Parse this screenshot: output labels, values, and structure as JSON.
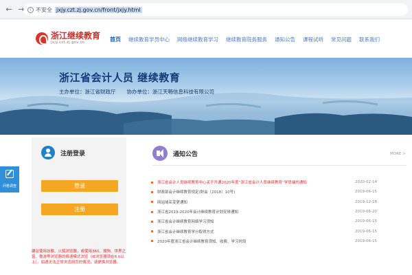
{
  "browser": {
    "back_glyph": "←",
    "forward_glyph": "→",
    "reload_glyph": "↻",
    "info_glyph": "i",
    "insecure_label": "不安全",
    "url": "jxjy.czt.zj.gov.cn/front/jxjy.html"
  },
  "header": {
    "logo_title": "浙江继续教育",
    "logo_sub": "jxjy.czt.zj.gov.cn",
    "nav": [
      {
        "label": "首页",
        "active": true
      },
      {
        "label": "继续教育学员中心"
      },
      {
        "label": "网络继续教育学习"
      },
      {
        "label": "继续教育院务服务"
      },
      {
        "label": "通知公告"
      },
      {
        "label": "课程试听"
      },
      {
        "label": "常见问题"
      },
      {
        "label": "联系我们"
      }
    ]
  },
  "banner": {
    "title": "浙江省会计人员 继续教育",
    "sponsor": "主办单位：浙江省财政厅",
    "co_organizer": "协办单位：浙江天畅信息科技有限公司"
  },
  "login_panel": {
    "title": "注册登录",
    "login_label": "登录",
    "register_label": "注册",
    "note": "建议使用谷歌、火狐浏览器，或使用360、搜狗、世界之窗、傲游等浏览器的极速模式浏览（IE浏览器须在8.0以上）。如遇无法正常浏览网页的情况，请更换浏览器。"
  },
  "float_widget": {
    "label": "问卷调查"
  },
  "notices": {
    "title": "通知公告",
    "more_label": "MORE >",
    "colors": {
      "hot": "#e03030",
      "bullet": "#e8702a"
    },
    "items": [
      {
        "text": "浙江省会计人员继续教育中心关于开通2020年度“浙江省会计人员继续教育”学员端的通知",
        "date": "2020-02-14",
        "hot": true
      },
      {
        "text": "财政部会计继续教育规定(财会〔2018〕10号)",
        "date": "2019-06-15"
      },
      {
        "text": "网站域名变更通知",
        "date": "2019-12-18"
      },
      {
        "text": "浙江省2019-2020年会计继续教育计划安排通知",
        "date": "2019-06-20"
      },
      {
        "text": "浙江省会计继续教育网络学习须知",
        "date": "2019-06-15"
      },
      {
        "text": "浙江省会计继续教育学分取得方式",
        "date": "2019-06-15"
      },
      {
        "text": "2020年度浙江省会计继续教育须知、收费、学习时段",
        "date": "2019-06-15"
      }
    ]
  }
}
